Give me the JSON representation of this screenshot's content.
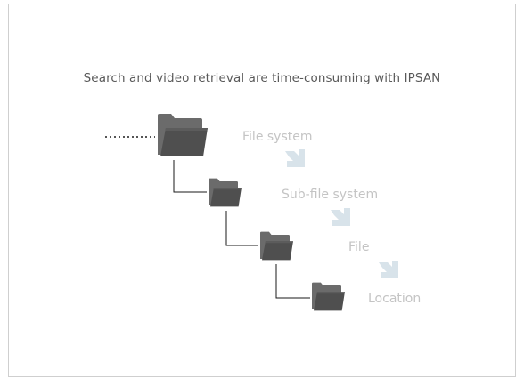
{
  "diagram": {
    "title": "Search and video retrieval are time-consuming with IPSAN",
    "levels": [
      {
        "label": "File system"
      },
      {
        "label": "Sub-file system"
      },
      {
        "label": "File"
      },
      {
        "label": "Location"
      }
    ],
    "colors": {
      "folder_back": "#6b6b6b",
      "folder_front": "#4f4f4f",
      "tree_line": "#1a1a1a",
      "dots": "#555555",
      "arrow": "#d8e3ea",
      "label": "#c4c4c4",
      "title": "#595959",
      "border": "#cfcfcf"
    },
    "icons": [
      "folder-icon",
      "down-right-arrow-icon"
    ]
  }
}
